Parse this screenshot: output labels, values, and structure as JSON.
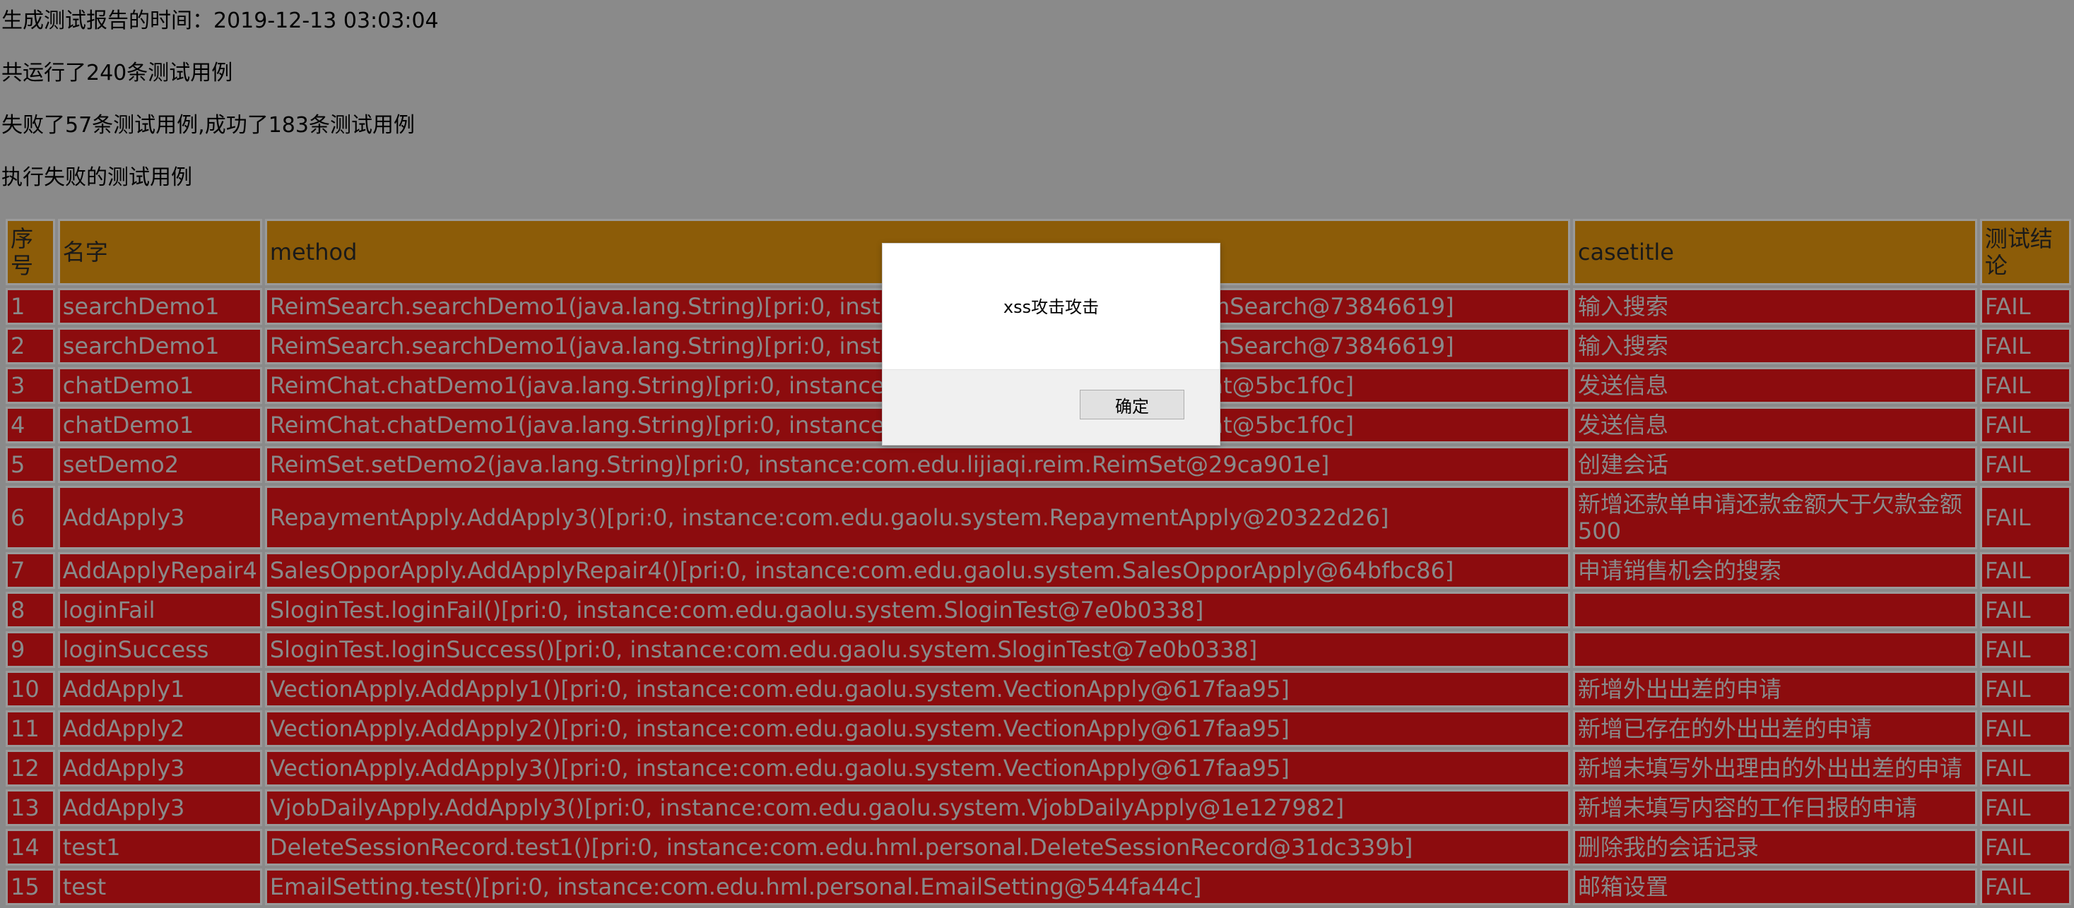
{
  "summary": {
    "time_line": "生成测试报告的时间：2019-12-13 03:03:04",
    "run_line": "共运行了240条测试用例",
    "result_line": "失败了57条测试用例,成功了183条测试用例",
    "failed_heading": "执行失败的测试用例"
  },
  "table": {
    "headers": [
      "序号",
      "名字",
      "method",
      "casetitle",
      "测试结论"
    ],
    "rows": [
      [
        "1",
        "searchDemo1",
        "ReimSearch.searchDemo1(java.lang.String)[pri:0, instance:com.edu.lijiaqi.reim.ReimSearch@73846619]",
        "输入搜索",
        "FAIL"
      ],
      [
        "2",
        "searchDemo1",
        "ReimSearch.searchDemo1(java.lang.String)[pri:0, instance:com.edu.lijiaqi.reim.ReimSearch@73846619]",
        "输入搜索",
        "FAIL"
      ],
      [
        "3",
        "chatDemo1",
        "ReimChat.chatDemo1(java.lang.String)[pri:0, instance:com.edu.lijiaqi.reim.ReimChat@5bc1f0c]",
        "发送信息",
        "FAIL"
      ],
      [
        "4",
        "chatDemo1",
        "ReimChat.chatDemo1(java.lang.String)[pri:0, instance:com.edu.lijiaqi.reim.ReimChat@5bc1f0c]",
        "发送信息",
        "FAIL"
      ],
      [
        "5",
        "setDemo2",
        "ReimSet.setDemo2(java.lang.String)[pri:0, instance:com.edu.lijiaqi.reim.ReimSet@29ca901e]",
        "创建会话",
        "FAIL"
      ],
      [
        "6",
        "AddApply3",
        "RepaymentApply.AddApply3()[pri:0, instance:com.edu.gaolu.system.RepaymentApply@20322d26]",
        "新增还款单申请还款金额大于欠款金额500",
        "FAIL"
      ],
      [
        "7",
        "AddApplyRepair4",
        "SalesOpporApply.AddApplyRepair4()[pri:0, instance:com.edu.gaolu.system.SalesOpporApply@64bfbc86]",
        "申请销售机会的搜索",
        "FAIL"
      ],
      [
        "8",
        "loginFail",
        "SloginTest.loginFail()[pri:0, instance:com.edu.gaolu.system.SloginTest@7e0b0338]",
        "",
        "FAIL"
      ],
      [
        "9",
        "loginSuccess",
        "SloginTest.loginSuccess()[pri:0, instance:com.edu.gaolu.system.SloginTest@7e0b0338]",
        "",
        "FAIL"
      ],
      [
        "10",
        "AddApply1",
        "VectionApply.AddApply1()[pri:0, instance:com.edu.gaolu.system.VectionApply@617faa95]",
        "新增外出出差的申请",
        "FAIL"
      ],
      [
        "11",
        "AddApply2",
        "VectionApply.AddApply2()[pri:0, instance:com.edu.gaolu.system.VectionApply@617faa95]",
        "新增已存在的外出出差的申请",
        "FAIL"
      ],
      [
        "12",
        "AddApply3",
        "VectionApply.AddApply3()[pri:0, instance:com.edu.gaolu.system.VectionApply@617faa95]",
        "新增未填写外出理由的外出出差的申请",
        "FAIL"
      ],
      [
        "13",
        "AddApply3",
        "VjobDailyApply.AddApply3()[pri:0, instance:com.edu.gaolu.system.VjobDailyApply@1e127982]",
        "新增未填写内容的工作日报的申请",
        "FAIL"
      ],
      [
        "14",
        "test1",
        "DeleteSessionRecord.test1()[pri:0, instance:com.edu.hml.personal.DeleteSessionRecord@31dc339b]",
        "删除我的会话记录",
        "FAIL"
      ],
      [
        "15",
        "test",
        "EmailSetting.test()[pri:0, instance:com.edu.hml.personal.EmailSetting@544fa44c]",
        "邮箱设置",
        "FAIL"
      ]
    ]
  },
  "dialog": {
    "message": "xss攻击攻击",
    "ok_label": "确定"
  },
  "colors": {
    "page_overlay": "#8a8a8a",
    "header_bg": "#8c5c08",
    "fail_row_bg": "#8c0c0e"
  }
}
